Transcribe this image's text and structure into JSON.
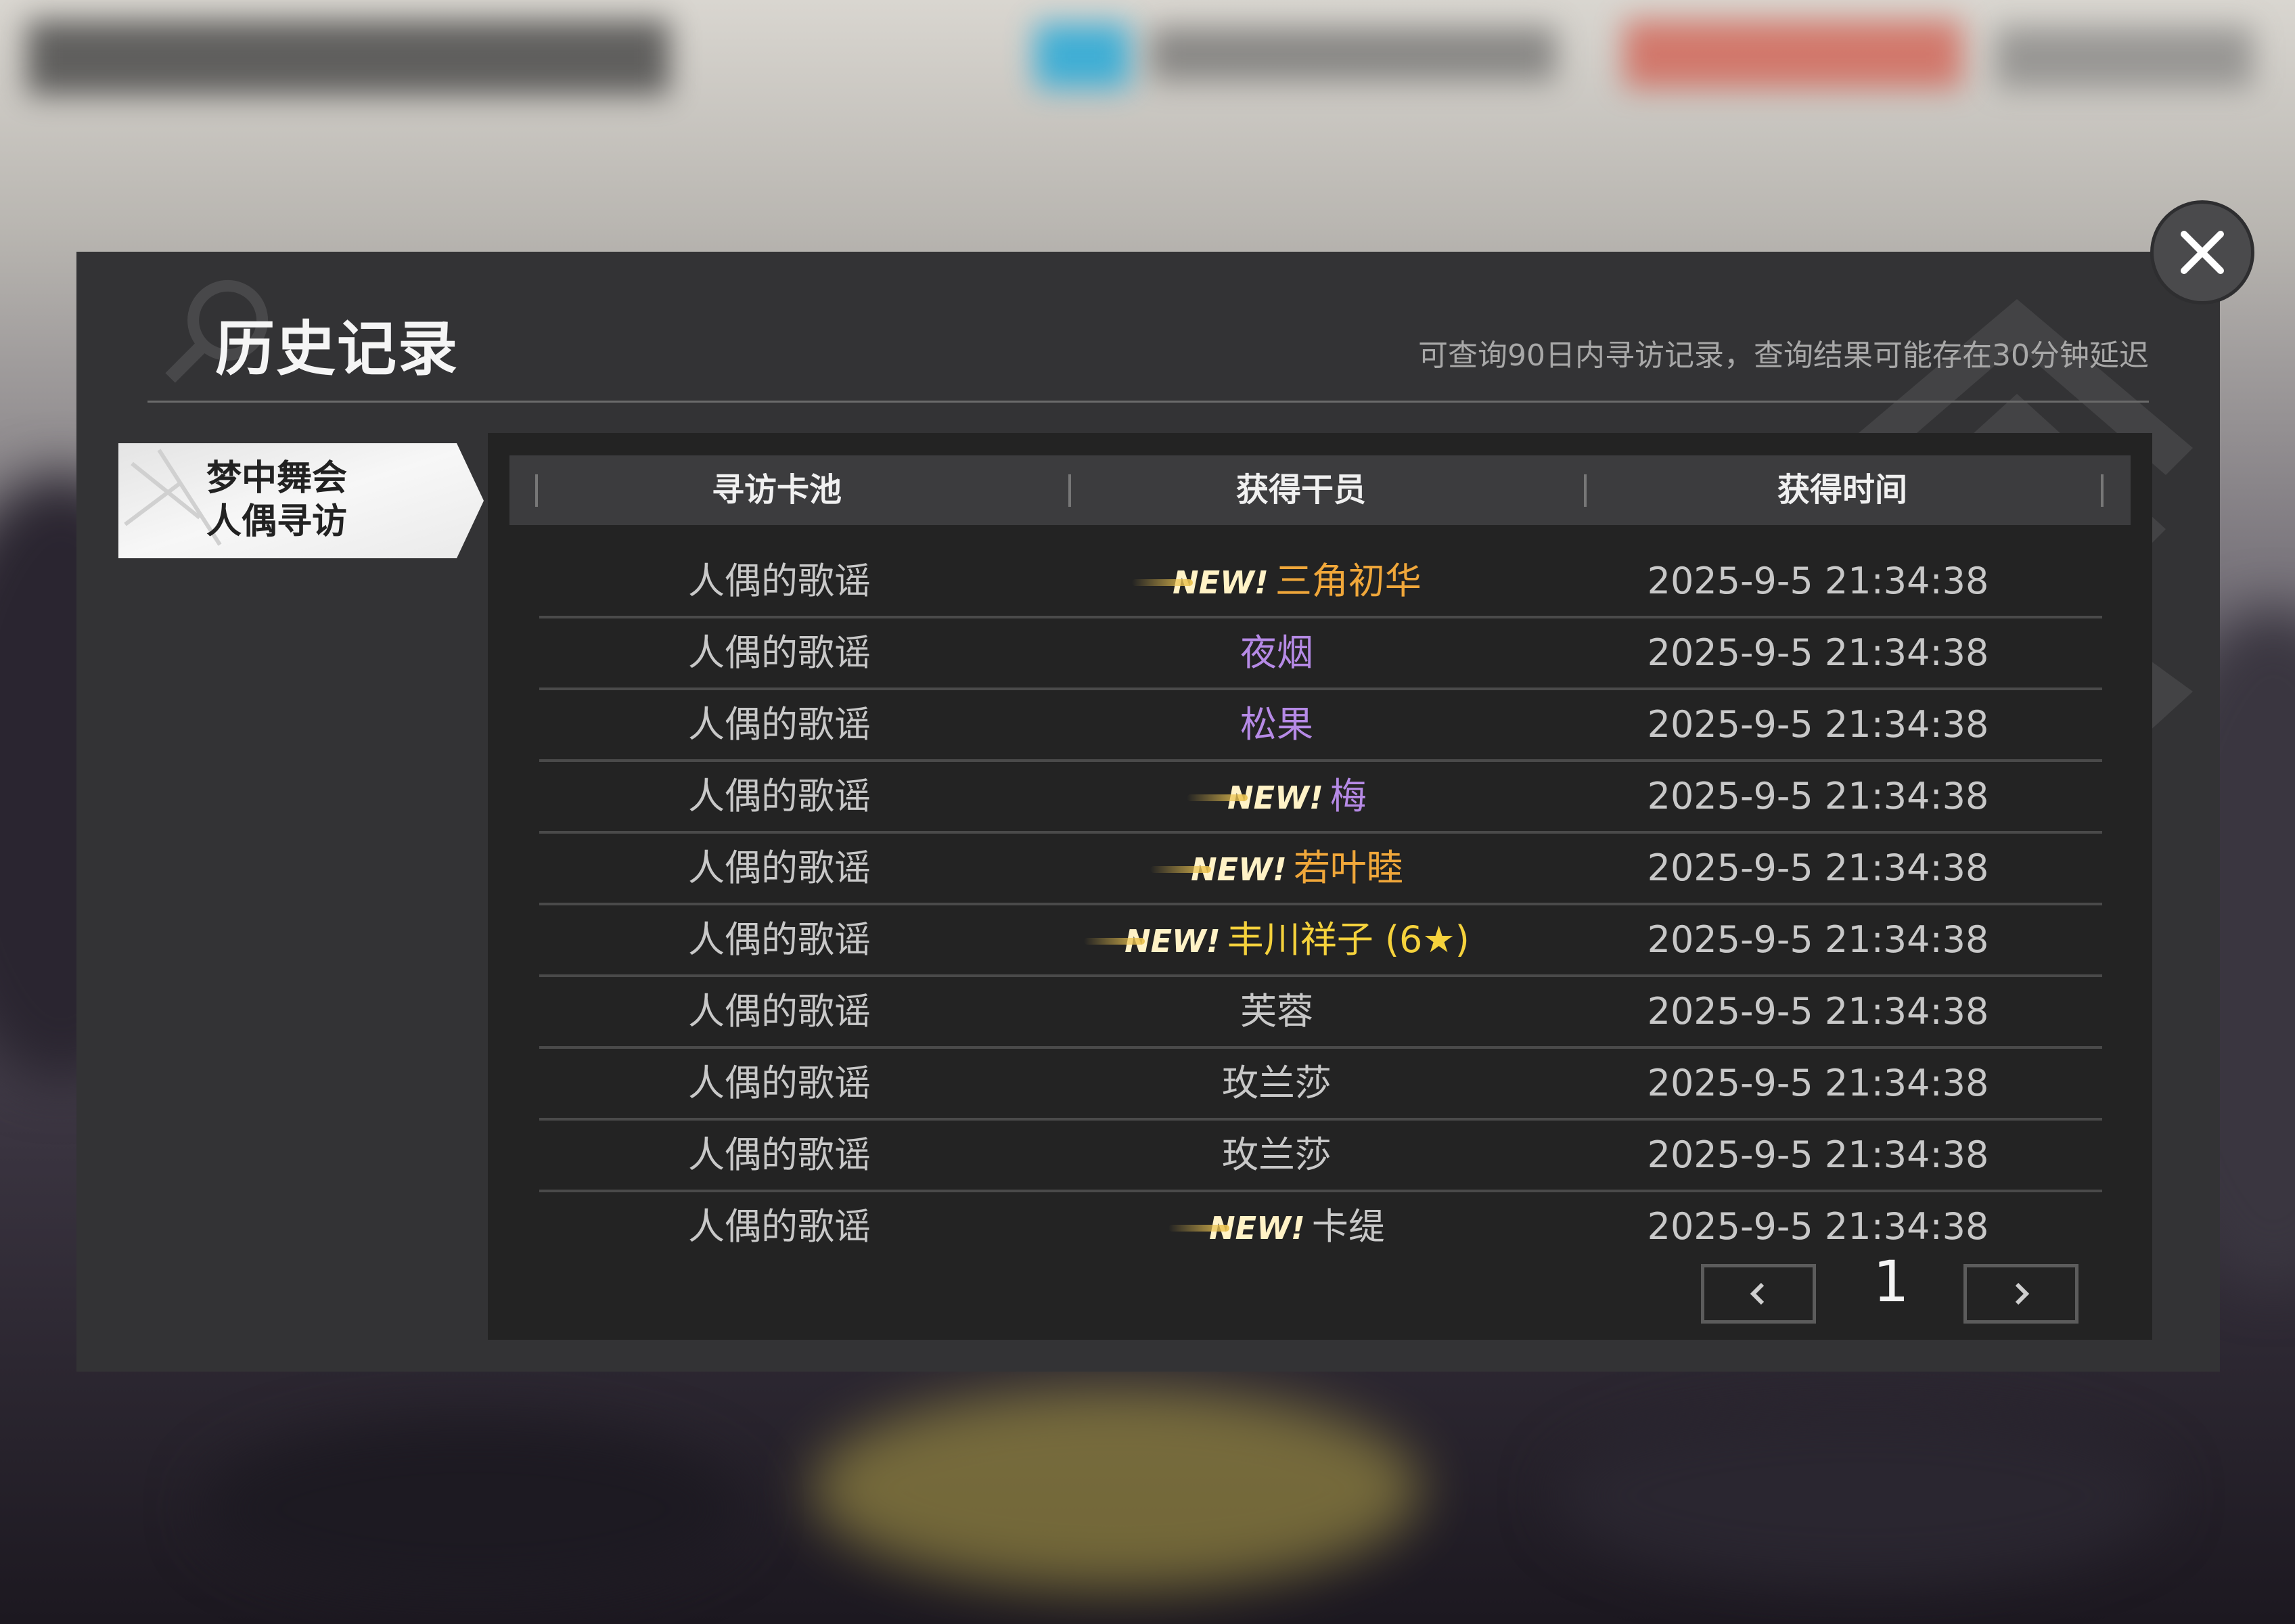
{
  "dialog": {
    "title": "历史记录",
    "notice": "可查询90日内寻访记录，查询结果可能存在30分钟延迟",
    "close_icon": "close-icon"
  },
  "tabs": [
    {
      "line1": "梦中舞会",
      "line2": "人偶寻访",
      "selected": true
    }
  ],
  "table": {
    "headers": [
      "寻访卡池",
      "获得干员",
      "获得时间"
    ],
    "new_label": "NEW!",
    "rows": [
      {
        "pool": "人偶的歌谣",
        "operator": "三角初华",
        "is_new": true,
        "rarity_color": "#f0a73a",
        "time": "2025-9-5 21:34:38"
      },
      {
        "pool": "人偶的歌谣",
        "operator": "夜烟",
        "is_new": false,
        "rarity_color": "#b68ae6",
        "time": "2025-9-5 21:34:38"
      },
      {
        "pool": "人偶的歌谣",
        "operator": "松果",
        "is_new": false,
        "rarity_color": "#b68ae6",
        "time": "2025-9-5 21:34:38"
      },
      {
        "pool": "人偶的歌谣",
        "operator": "梅",
        "is_new": true,
        "rarity_color": "#b68ae6",
        "time": "2025-9-5 21:34:38"
      },
      {
        "pool": "人偶的歌谣",
        "operator": "若叶睦",
        "is_new": true,
        "rarity_color": "#f0a73a",
        "time": "2025-9-5 21:34:38"
      },
      {
        "pool": "人偶的歌谣",
        "operator": "丰川祥子 (6★)",
        "is_new": true,
        "rarity_color": "#f5d23c",
        "time": "2025-9-5 21:34:38"
      },
      {
        "pool": "人偶的歌谣",
        "operator": "芙蓉",
        "is_new": false,
        "rarity_color": "#c8c8c8",
        "time": "2025-9-5 21:34:38"
      },
      {
        "pool": "人偶的歌谣",
        "operator": "玫兰莎",
        "is_new": false,
        "rarity_color": "#c8c8c8",
        "time": "2025-9-5 21:34:38"
      },
      {
        "pool": "人偶的歌谣",
        "operator": "玫兰莎",
        "is_new": false,
        "rarity_color": "#c8c8c8",
        "time": "2025-9-5 21:34:38"
      },
      {
        "pool": "人偶的歌谣",
        "operator": "卡缇",
        "is_new": true,
        "rarity_color": "#c8c8c8",
        "time": "2025-9-5 21:34:38"
      }
    ]
  },
  "pagination": {
    "current_page": "1",
    "prev_icon": "chevron-left-icon",
    "next_icon": "chevron-right-icon"
  }
}
